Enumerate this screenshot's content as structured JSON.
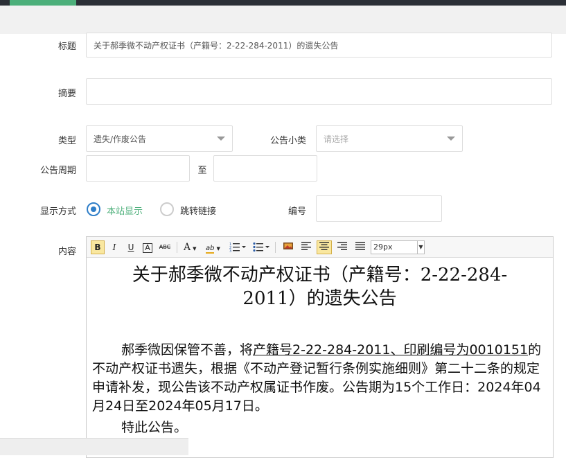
{
  "form": {
    "title_label": "标题",
    "title_value": "关于郝季微不动产权证书（产籍号：2-22-284-2011）的遗失公告",
    "summary_label": "摘要",
    "summary_value": "",
    "type_label": "类型",
    "type_value": "遗失/作废公告",
    "subtype_label": "公告小类",
    "subtype_placeholder": "请选择",
    "period_label": "公告周期",
    "period_to": "至",
    "display_label": "显示方式",
    "display_option_1": "本站显示",
    "display_option_2": "跳转链接",
    "number_label": "编号",
    "content_label": "内容"
  },
  "editor": {
    "font_size": "29px",
    "tools": {
      "bold": "B",
      "italic": "I",
      "underline": "U",
      "font_border": "A",
      "strike": "ABC",
      "font_color": "A",
      "highlight": "ab"
    },
    "doc_title": "关于郝季微不动产权证书（产籍号：2-22-284-2011）的遗失公告",
    "body_prefix": "郝季微因保管不善，将",
    "body_underlined": "产籍号2-22-284-2011、印刷编号为0010151",
    "body_suffix": "的不动产权证书遗失，根据《不动产登记暂行条例实施细则》第二十二条的规定申请补发，现公告该不动产权属证书作废。公告期为15个工作日：2024年04月24日至2024年05月17日。",
    "signoff": "特此公告。"
  },
  "colors": {
    "accent": "#4caf7a",
    "radio_active": "#2f7ec8",
    "option_active_text": "#4caf7a"
  }
}
